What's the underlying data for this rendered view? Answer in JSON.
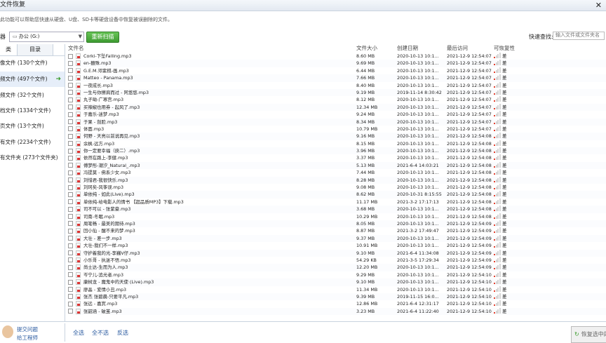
{
  "window": {
    "title": "文件恢复",
    "close": "✕"
  },
  "info": "此功能可以帮助您快速从硬盘、U盘、SD卡等硬盘设备中恢复被误删除的文件。",
  "toolbar": {
    "device_label": "器",
    "device_value": "办公 (G:)",
    "rescan_label": "重新扫描",
    "quick_search_label": "快速查找:",
    "quick_search_placeholder": "输入文件或文件夹名"
  },
  "left_tabs": [
    "类",
    "目录"
  ],
  "categories": [
    {
      "label": "像文件 (130个文件)"
    },
    {
      "label": "频文件 (497个文件)",
      "selected": true
    },
    {
      "label": "频文件 (32个文件)"
    },
    {
      "label": "档文件 (1334个文件)"
    },
    {
      "label": "页文件 (13个文件)"
    },
    {
      "label": "有文件 (2234个文件)"
    },
    {
      "label": "有文件夹 (273个文件夹)"
    }
  ],
  "columns": {
    "name": "文件名",
    "size": "文件大小",
    "created": "创建日期",
    "accessed": "最后访问",
    "recoverability": "可恢复性"
  },
  "files": [
    {
      "name": "Corki-下坠Falling.mp3",
      "size": "8.60 MB",
      "created": "2020-10-13 10:1...",
      "accessed": "2021-12-9 12:54:07",
      "rec": "差"
    },
    {
      "name": "en-囍殊.mp3",
      "size": "9.69 MB",
      "created": "2020-10-13 10:1...",
      "accessed": "2021-12-9 12:54:07",
      "rec": "差"
    },
    {
      "name": "G.E.M.邓紫棋-画.mp3",
      "size": "6.44 MB",
      "created": "2020-10-13 10:1...",
      "accessed": "2021-12-9 12:54:07",
      "rec": "差"
    },
    {
      "name": "Matteo - Panama.mp3",
      "size": "7.66 MB",
      "created": "2020-10-13 10:1...",
      "accessed": "2021-12-9 12:54:07",
      "rec": "差"
    },
    {
      "name": "一夜成长.mp3",
      "size": "8.40 MB",
      "created": "2020-10-13 10:1...",
      "accessed": "2021-12-9 12:54:07",
      "rec": "差"
    },
    {
      "name": "一生与你擦肩而过 - 阿悠悠.mp3",
      "size": "9.19 MB",
      "created": "2019-11-14 8:30:42",
      "accessed": "2021-12-9 12:54:07",
      "rec": "差"
    },
    {
      "name": "丸子呦-广寒宫.mp3",
      "size": "8.12 MB",
      "created": "2020-10-13 10:1...",
      "accessed": "2021-12-9 12:54:07",
      "rec": "差"
    },
    {
      "name": "买辣椒也用券 - 起风了.mp3",
      "size": "12.34 MB",
      "created": "2020-10-13 10:1...",
      "accessed": "2021-12-9 12:54:07",
      "rec": "差"
    },
    {
      "name": "于嘉乐-迷梦.mp3",
      "size": "9.24 MB",
      "created": "2020-10-13 10:1...",
      "accessed": "2021-12-9 12:54:07",
      "rec": "差"
    },
    {
      "name": "于果 - 剖脸.mp3",
      "size": "8.34 MB",
      "created": "2020-10-13 10:1...",
      "accessed": "2021-12-9 12:54:07",
      "rec": "差"
    },
    {
      "name": "体面.mp3",
      "size": "10.79 MB",
      "created": "2020-10-13 10:1...",
      "accessed": "2021-12-9 12:54:07",
      "rec": "差"
    },
    {
      "name": "何野 - 天亮以前说再见.mp3",
      "size": "9.16 MB",
      "created": "2020-10-13 10:1...",
      "accessed": "2021-12-9 12:54:08",
      "rec": "差"
    },
    {
      "name": "余枫-远方.mp3",
      "size": "8.15 MB",
      "created": "2020-10-13 10:1...",
      "accessed": "2021-12-9 12:54:08",
      "rec": "差"
    },
    {
      "name": "你一定要幸福（庾二）.mp3",
      "size": "3.96 MB",
      "created": "2020-10-13 10:1...",
      "accessed": "2021-12-9 12:54:08",
      "rec": "差"
    },
    {
      "name": "依然在路上-李健.mp3",
      "size": "3.37 MB",
      "created": "2020-10-13 10:1...",
      "accessed": "2021-12-9 12:54:08",
      "rec": "差"
    },
    {
      "name": "傅梦彤-潮汐_Natural_.mp3",
      "size": "5.13 MB",
      "created": "2021-6-4 14:03:21",
      "accessed": "2021-12-9 12:54:08",
      "rec": "差"
    },
    {
      "name": "冯提莫 - 佛系少女.mp3",
      "size": "7.44 MB",
      "created": "2020-10-13 10:1...",
      "accessed": "2021-12-9 12:54:08",
      "rec": "差"
    },
    {
      "name": "刘惜君-我很快乐.mp3",
      "size": "8.28 MB",
      "created": "2020-10-13 10:1...",
      "accessed": "2021-12-9 12:54:08",
      "rec": "差"
    },
    {
      "name": "刘珂矣-风筝误.mp3",
      "size": "9.08 MB",
      "created": "2020-10-13 10:1...",
      "accessed": "2021-12-9 12:54:08",
      "rec": "差"
    },
    {
      "name": "单依纯 - 如此(Live).mp3",
      "size": "8.62 MB",
      "created": "2020-10-31 8:15:55",
      "accessed": "2021-12-9 12:54:08",
      "rec": "差"
    },
    {
      "name": "单依纯-给电影人的情书 【超品质MP3】下载.mp3",
      "size": "11.17 MB",
      "created": "2021-3-2 17:17:13",
      "accessed": "2021-12-9 12:54:08",
      "rec": "差"
    },
    {
      "name": "司不可以 - 张紫豪.mp3",
      "size": "3.68 MB",
      "created": "2020-10-13 10:1...",
      "accessed": "2021-12-9 12:54:08",
      "rec": "差"
    },
    {
      "name": "司南-冬眠.mp3",
      "size": "10.29 MB",
      "created": "2020-10-13 10:1...",
      "accessed": "2021-12-9 12:54:08",
      "rec": "差"
    },
    {
      "name": "周笔畅 - 最美的期待.mp3",
      "size": "8.05 MB",
      "created": "2020-10-13 10:1...",
      "accessed": "2021-12-9 12:54:09",
      "rec": "差"
    },
    {
      "name": "回小仙 - 醒不来的梦.mp3",
      "size": "8.87 MB",
      "created": "2021-3-2 17:49:47",
      "accessed": "2021-12-9 12:54:09",
      "rec": "差"
    },
    {
      "name": "大壮 - 差一步.mp3",
      "size": "9.37 MB",
      "created": "2020-10-13 10:1...",
      "accessed": "2021-12-9 12:54:09",
      "rec": "差"
    },
    {
      "name": "大壮-我们不一样.mp3",
      "size": "10.91 MB",
      "created": "2020-10-13 10:1...",
      "accessed": "2021-12-9 12:54:09",
      "rec": "差"
    },
    {
      "name": "守护着我的光-李巍V仔.mp3",
      "size": "9.10 MB",
      "created": "2021-6-4 11:34:08",
      "accessed": "2021-12-9 12:54:09",
      "rec": "差"
    },
    {
      "name": "小乐哥 - 执迷不悟.mp3",
      "size": "54.29 KB",
      "created": "2021-3-5 17:29:34",
      "accessed": "2021-12-9 12:54:09",
      "rec": "差"
    },
    {
      "name": "尚士达-生而为人.mp3",
      "size": "12.20 MB",
      "created": "2020-10-13 10:1...",
      "accessed": "2021-12-9 12:54:09",
      "rec": "差"
    },
    {
      "name": "岑宁儿-追光者.mp3",
      "size": "9.29 MB",
      "created": "2020-10-13 10:1...",
      "accessed": "2021-12-9 12:54:10",
      "rec": "差"
    },
    {
      "name": "康树龙 - 魔鬼中的天使 (Live).mp3",
      "size": "9.10 MB",
      "created": "2020-10-13 10:1...",
      "accessed": "2021-12-9 12:54:10",
      "rec": "差"
    },
    {
      "name": "廖晶 - 爱情小丑.mp3",
      "size": "11.34 MB",
      "created": "2020-10-13 10:1...",
      "accessed": "2021-12-9 12:54:10",
      "rec": "差"
    },
    {
      "name": "张杰 张碧晨-只要平凡.mp3",
      "size": "9.39 MB",
      "created": "2019-11-15 16:0...",
      "accessed": "2021-12-9 12:54:10",
      "rec": "差"
    },
    {
      "name": "张远 - 嘉宾.mp3",
      "size": "12.86 MB",
      "created": "2021-6-4 12:31:17",
      "accessed": "2021-12-9 12:54:10",
      "rec": "差"
    },
    {
      "name": "张韶涵 - 破茧.mp3",
      "size": "3.23 MB",
      "created": "2021-6-4 11:22:40",
      "accessed": "2021-12-9 12:54:10",
      "rec": "差"
    }
  ],
  "recoverability_level": 1,
  "bottom": {
    "help_line1": "提交问题",
    "help_line2": "给工程师",
    "select_all": "全选",
    "select_none": "全不选",
    "invert": "反选",
    "recover_label": "恢复选中的"
  }
}
